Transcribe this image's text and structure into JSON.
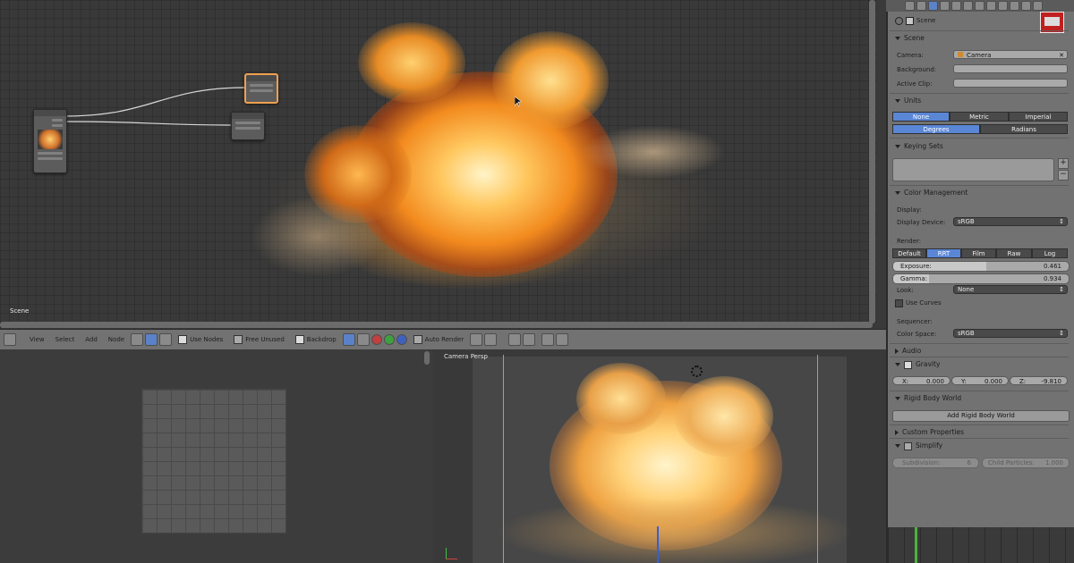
{
  "node_editor": {
    "area_label": "Scene"
  },
  "node_header": {
    "menu": [
      "View",
      "Select",
      "Add",
      "Node"
    ],
    "use_nodes": {
      "label": "Use Nodes",
      "checked": true
    },
    "free_unused": {
      "label": "Free Unused",
      "checked": false
    },
    "backdrop": {
      "label": "Backdrop",
      "checked": true
    },
    "auto_render": {
      "label": "Auto Render",
      "checked": false
    }
  },
  "viewport": {
    "label": "Camera Persp"
  },
  "properties": {
    "header_label": "Scene",
    "scene_panel": {
      "title": "Scene",
      "camera_label": "Camera:",
      "camera_value": "Camera",
      "background_label": "Background:",
      "active_clip_label": "Active Clip:"
    },
    "units_panel": {
      "title": "Units",
      "systems": [
        "None",
        "Metric",
        "Imperial"
      ],
      "selected_system": "None",
      "rotation": [
        "Degrees",
        "Radians"
      ],
      "selected_rotation": "Degrees"
    },
    "keying_sets_panel": {
      "title": "Keying Sets"
    },
    "color_management_panel": {
      "title": "Color Management",
      "display_heading": "Display:",
      "display_device_label": "Display Device:",
      "display_device_value": "sRGB",
      "render_heading": "Render:",
      "views": [
        "Default",
        "RRT",
        "Film",
        "Raw",
        "Log"
      ],
      "selected_view": "RRT",
      "exposure_label": "Exposure:",
      "exposure_value": "0.461",
      "gamma_label": "Gamma:",
      "gamma_value": "0.934",
      "look_label": "Look:",
      "look_value": "None",
      "use_curves_label": "Use Curves",
      "sequencer_heading": "Sequencer:",
      "color_space_label": "Color Space:",
      "color_space_value": "sRGB"
    },
    "audio_panel": {
      "title": "Audio"
    },
    "gravity_panel": {
      "title": "Gravity",
      "x_label": "X:",
      "x_value": "0.000",
      "y_label": "Y:",
      "y_value": "0.000",
      "z_label": "Z:",
      "z_value": "-9.810"
    },
    "rigid_body_panel": {
      "title": "Rigid Body World",
      "button": "Add Rigid Body World"
    },
    "custom_properties_panel": {
      "title": "Custom Properties"
    },
    "simplify_panel": {
      "title": "Simplify",
      "subdivision_label": "Subdivision:",
      "subdivision_value": "6",
      "child_particles_label": "Child Particles:",
      "child_particles_value": "1.000"
    }
  },
  "colors": {
    "selection_blue": "#5a86d6",
    "camera_frame_orange": "#e0942a",
    "selected_node_outline": "#f0a050"
  }
}
